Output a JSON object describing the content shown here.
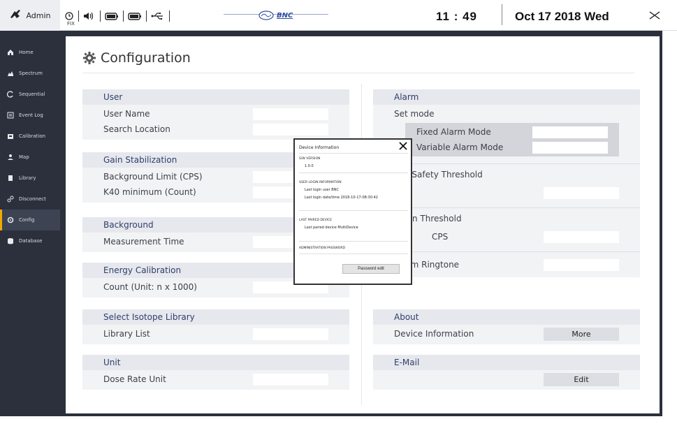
{
  "topbar": {
    "admin_label": "Admin",
    "fix_label": "FIX",
    "logo_text": "BNC",
    "time": "11 : 49",
    "date": "Oct 17 2018 Wed",
    "icons": [
      "alarm-clock-icon",
      "speaker-icon",
      "battery-l-icon",
      "battery-r-icon",
      "usb-icon"
    ]
  },
  "sidebar": {
    "items": [
      {
        "label": "Home",
        "icon": "home-icon"
      },
      {
        "label": "Spectrum",
        "icon": "spectrum-icon"
      },
      {
        "label": "Sequential",
        "icon": "sequential-icon"
      },
      {
        "label": "Event Log",
        "icon": "event-log-icon"
      },
      {
        "label": "Calibration",
        "icon": "calibration-icon"
      },
      {
        "label": "Map",
        "icon": "map-icon"
      },
      {
        "label": "Library",
        "icon": "library-icon"
      },
      {
        "label": "Disconnect",
        "icon": "disconnect-icon"
      },
      {
        "label": "Config",
        "icon": "config-icon",
        "active": true
      },
      {
        "label": "Database",
        "icon": "database-icon"
      }
    ],
    "accent": "#f2a900"
  },
  "page": {
    "title": "Configuration"
  },
  "left": {
    "user": {
      "title": "User",
      "user_name": "User Name",
      "search_location": "Search Location"
    },
    "gain": {
      "title": "Gain Stabilization",
      "background_limit": "Background Limit (CPS)",
      "k40": "K40 minimum (Count)"
    },
    "background": {
      "title": "Background",
      "measurement_time": "Measurement Time"
    },
    "energy": {
      "title": "Energy Calibration",
      "count": "Count (Unit: n x 1000)"
    },
    "isotope": {
      "title": "Select Isotope Library",
      "library_list": "Library List"
    },
    "unit": {
      "title": "Unit",
      "dose_rate": "Dose Rate Unit"
    }
  },
  "right": {
    "alarm": {
      "title": "Alarm",
      "set_mode": "Set mode",
      "fixed_mode": "Fixed Alarm Mode",
      "variable_mode": "Variable Alarm Mode",
      "health_threshold": "h Safety Threshold",
      "neutron_threshold": "ron Threshold",
      "cps": "CPS",
      "ringtone": "Alarm Ringtone"
    },
    "about": {
      "title": "About",
      "device_info": "Device Information",
      "more_button": "More"
    },
    "email": {
      "title": "E-Mail",
      "edit_button": "Edit"
    }
  },
  "dialog": {
    "title": "Device Information",
    "sw_version_label": "S/W VERSION",
    "sw_version": "1.0.0",
    "login_label": "USER LOGIN INFORMATION",
    "last_login_user": "Last login user BNC",
    "last_login_datetime": "Last login date/time 2018-10-17-08:30:42",
    "paired_label": "LAST PAIRED DEVICE",
    "last_paired": "Last paired device MultiDevice",
    "admin_pw_label": "ADMINISTRATION PASSWORD",
    "password_edit_button": "Password edit"
  }
}
